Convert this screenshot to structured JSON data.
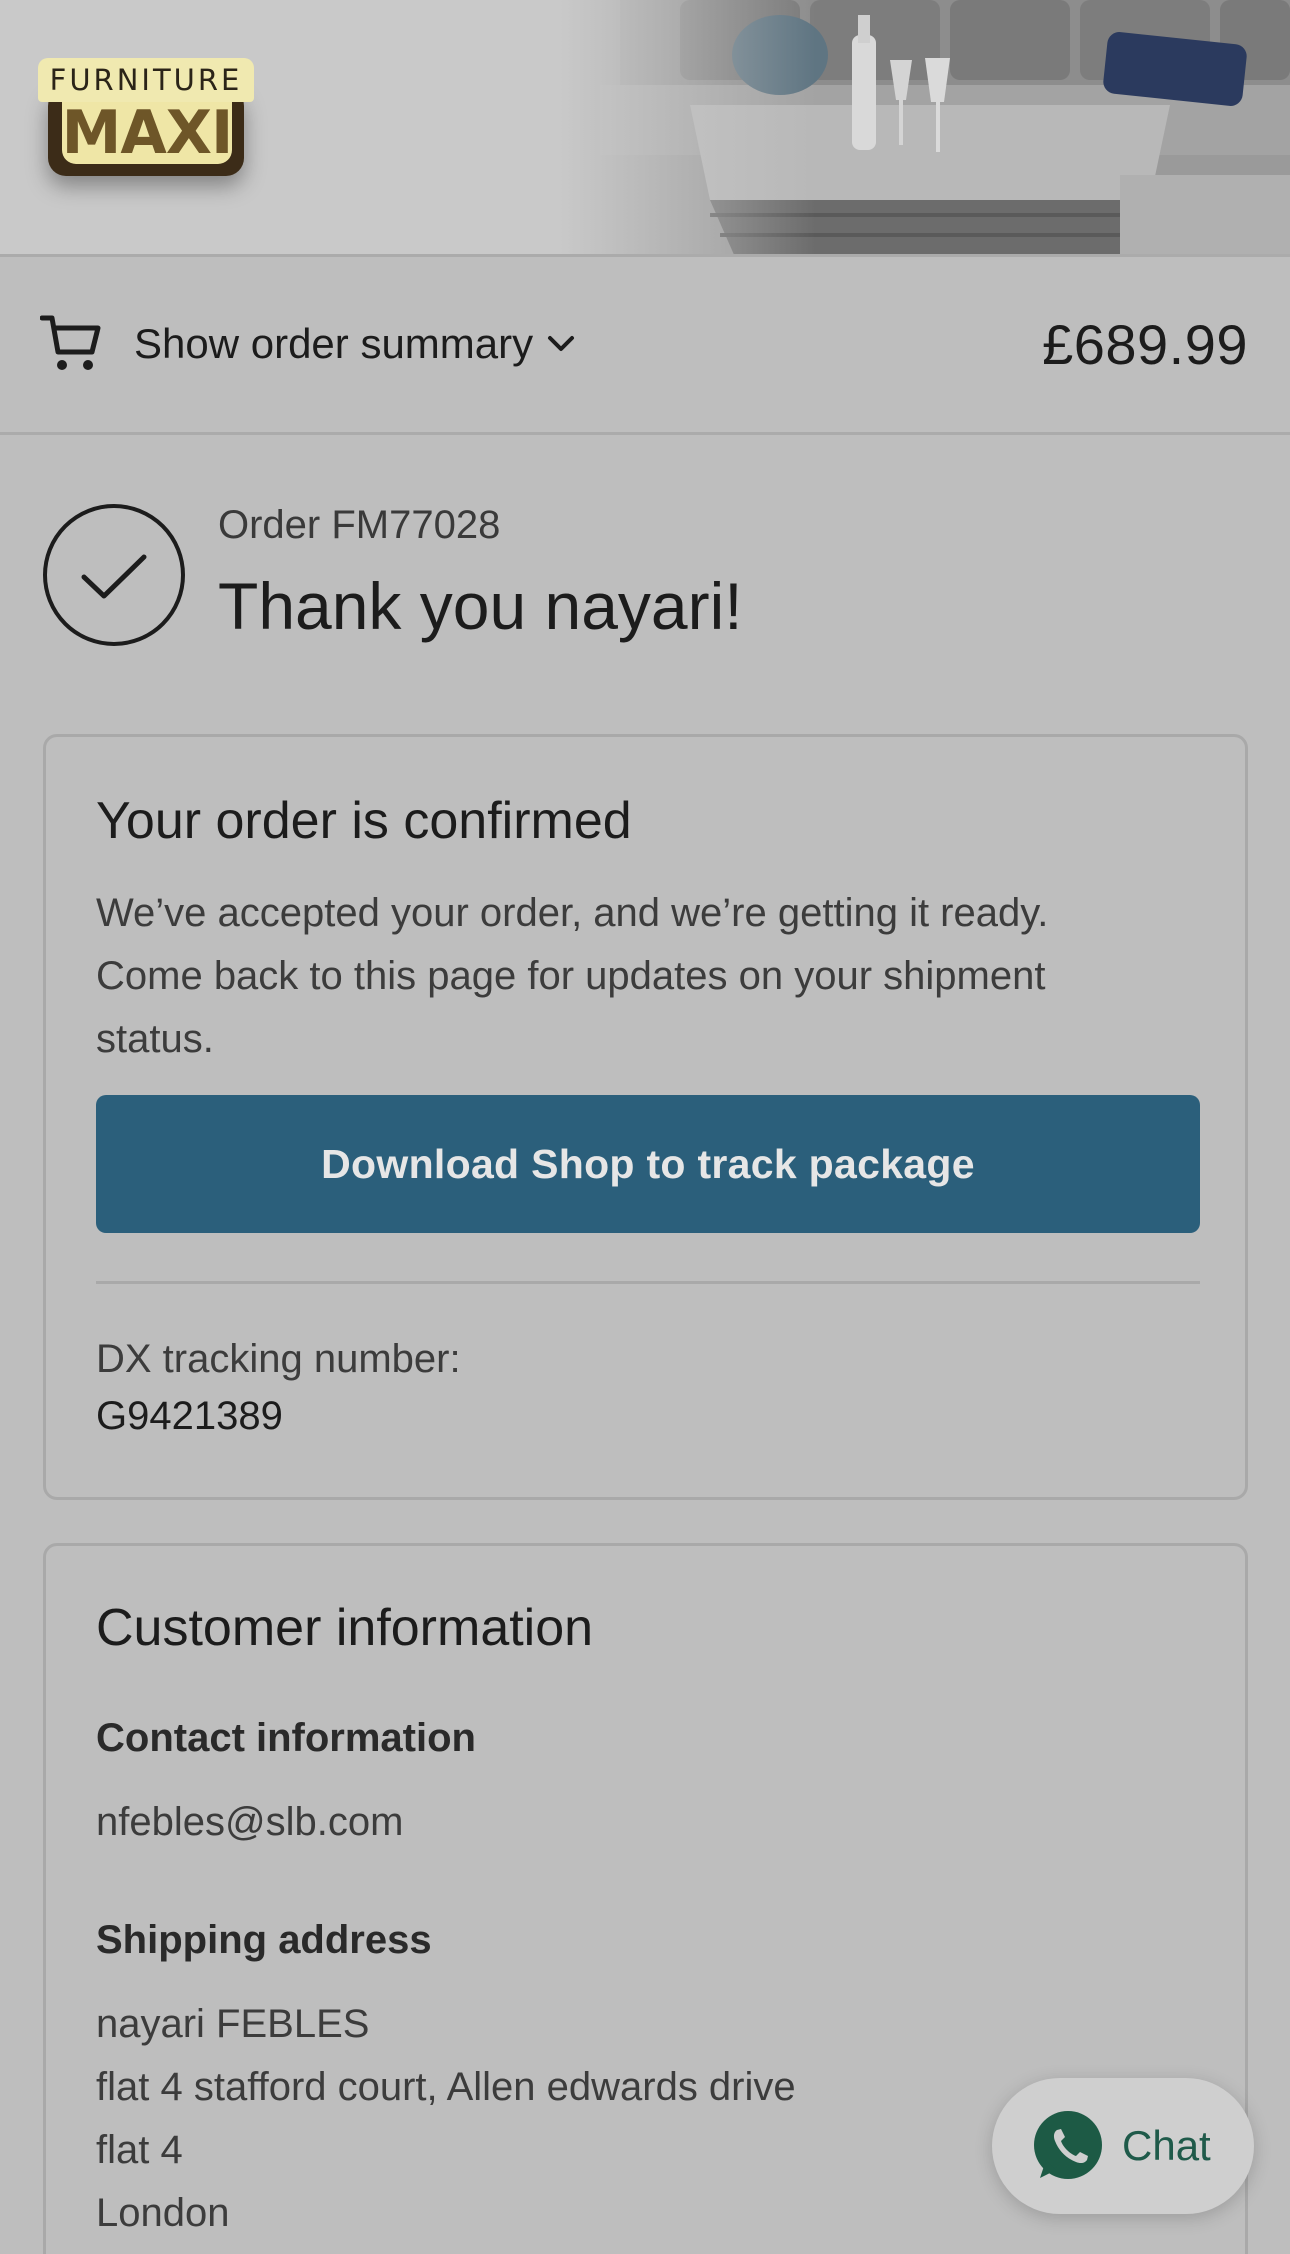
{
  "header": {
    "logo_top": "FURNITURE",
    "logo_main": "MAXI"
  },
  "summary": {
    "toggle_label": "Show order summary",
    "total": "£689.99"
  },
  "order": {
    "number": "Order FM77028",
    "thank_you": "Thank you nayari!"
  },
  "confirmation": {
    "title": "Your order is confirmed",
    "lines": [
      "We’ve accepted your order, and we’re getting it ready.",
      "Come back to this page for updates on your shipment",
      "status."
    ],
    "button_label": "Download Shop to track package",
    "tracking_label": "DX tracking number:",
    "tracking_number": "G9421389"
  },
  "customer": {
    "title": "Customer information",
    "contact_heading": "Contact information",
    "email": "nfebles@slb.com",
    "shipping_heading": "Shipping address",
    "address": [
      "nayari FEBLES",
      "flat 4 stafford court, Allen edwards drive",
      "flat 4",
      "London"
    ]
  },
  "chat": {
    "label": "Chat"
  },
  "colors": {
    "button": "#2b5f7b",
    "chat_icon": "#1d5a45",
    "background": "#bebebe"
  }
}
